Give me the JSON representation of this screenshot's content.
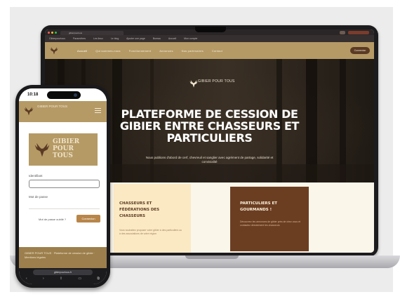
{
  "laptop": {
    "browser": {
      "tab_title": "gibierpourtous",
      "bookmarks": [
        "Gibierpourtous",
        "Paramètres",
        "Les lieux",
        "Le blog",
        "Ajouter une page",
        "Bureau",
        "Accueil",
        "Mon compte"
      ]
    },
    "nav": {
      "links": [
        "Accueil",
        "Qui sommes-nous",
        "Fonctionnement",
        "Annonces",
        "Nos partenaires",
        "Contact"
      ],
      "cta": "Connexion"
    },
    "hero": {
      "brand": "GIBIER POUR TOUS",
      "title": "PLATEFORME DE CESSION DE GIBIER ENTRE CHASSEURS ET PARTICULIERS",
      "subtitle": "Nous publions d'abord de cerf, chevreuil et sanglier avec agrément de partage, solidarité et convivialité"
    },
    "cards": {
      "hunters": {
        "title": "CHASSEURS ET FÉDÉRATIONS DES CHASSEURS",
        "text": "Vous souhaitez proposer votre gibier à des particuliers ou à des associations de votre région"
      },
      "gourmets": {
        "title": "PARTICULIERS ET GOURMANDS !",
        "text": "Découvrez les annonces de gibier près de chez vous et contactez directement les chasseurs"
      }
    }
  },
  "phone": {
    "time": "10:18",
    "header_brand": "GIBIER POUR TOUS",
    "logo_text": "GIBIER POUR TOUS",
    "username_label": "Identifiant",
    "password_label": "Mot de passe",
    "forgot_label": "Mot de passe oublié ?",
    "login_button": "Connexion",
    "footer_text": "GIBIER POUR TOUS · Plateforme de cession de gibier · Mentions légales",
    "url": "gibierpourtous.fr",
    "nav_icons": [
      "back-icon",
      "forward-icon",
      "share-icon",
      "bookmarks-icon",
      "tabs-icon"
    ]
  },
  "colors": {
    "brand_tan": "#b59a66",
    "brand_brown": "#6b3e22",
    "cream": "#fbe9c4",
    "accent_button": "#b8864a"
  }
}
